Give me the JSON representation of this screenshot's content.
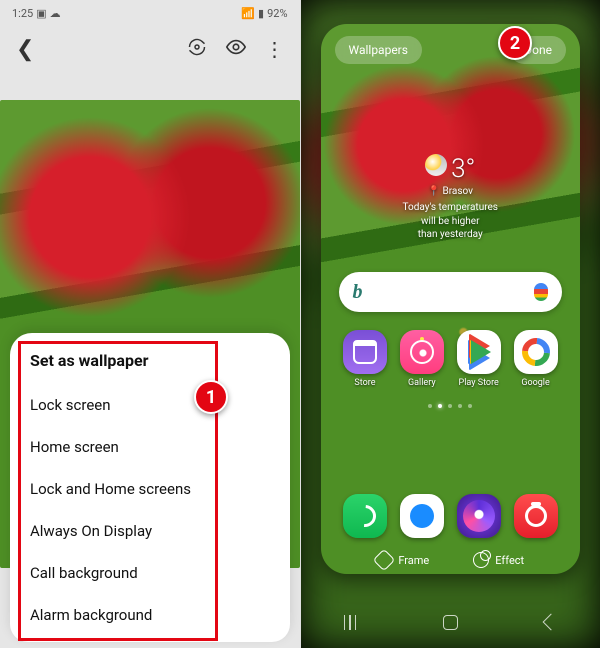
{
  "status": {
    "time": "1:25",
    "battery": "92%"
  },
  "sheet": {
    "title": "Set as wallpaper",
    "options": {
      "lock": "Lock screen",
      "home": "Home screen",
      "both": "Lock and Home screens",
      "aod": "Always On Display",
      "call": "Call background",
      "alarm": "Alarm background"
    }
  },
  "preview": {
    "wallpapers": "Wallpapers",
    "done": "Done",
    "weather": {
      "temp": "3°",
      "location": "Brasov",
      "line1": "Today's temperatures",
      "line2": "will be higher",
      "line3": "than yesterday"
    },
    "apps": {
      "store": "Store",
      "gallery": "Gallery",
      "play": "Play Store",
      "google": "Google"
    },
    "frame": "Frame",
    "effect": "Effect"
  },
  "annotations": {
    "step1": "1",
    "step2": "2"
  }
}
